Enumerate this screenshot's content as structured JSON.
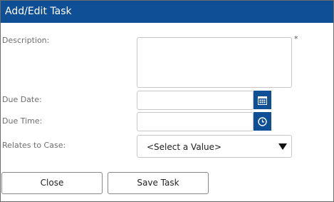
{
  "dialog": {
    "title": "Add/Edit Task"
  },
  "form": {
    "description_label": "Description:",
    "required_marker": "*",
    "due_date_label": "Due Date:",
    "due_time_label": "Due Time:",
    "relates_label": "Relates to Case:",
    "relates_value": "<Select a Value>"
  },
  "buttons": {
    "close": "Close",
    "save": "Save Task"
  },
  "icons": {
    "date_picker": "calendar-icon",
    "time_picker": "clock-icon",
    "select_arrow": "caret-down-icon"
  },
  "colors": {
    "accent": "#0e4f96"
  }
}
